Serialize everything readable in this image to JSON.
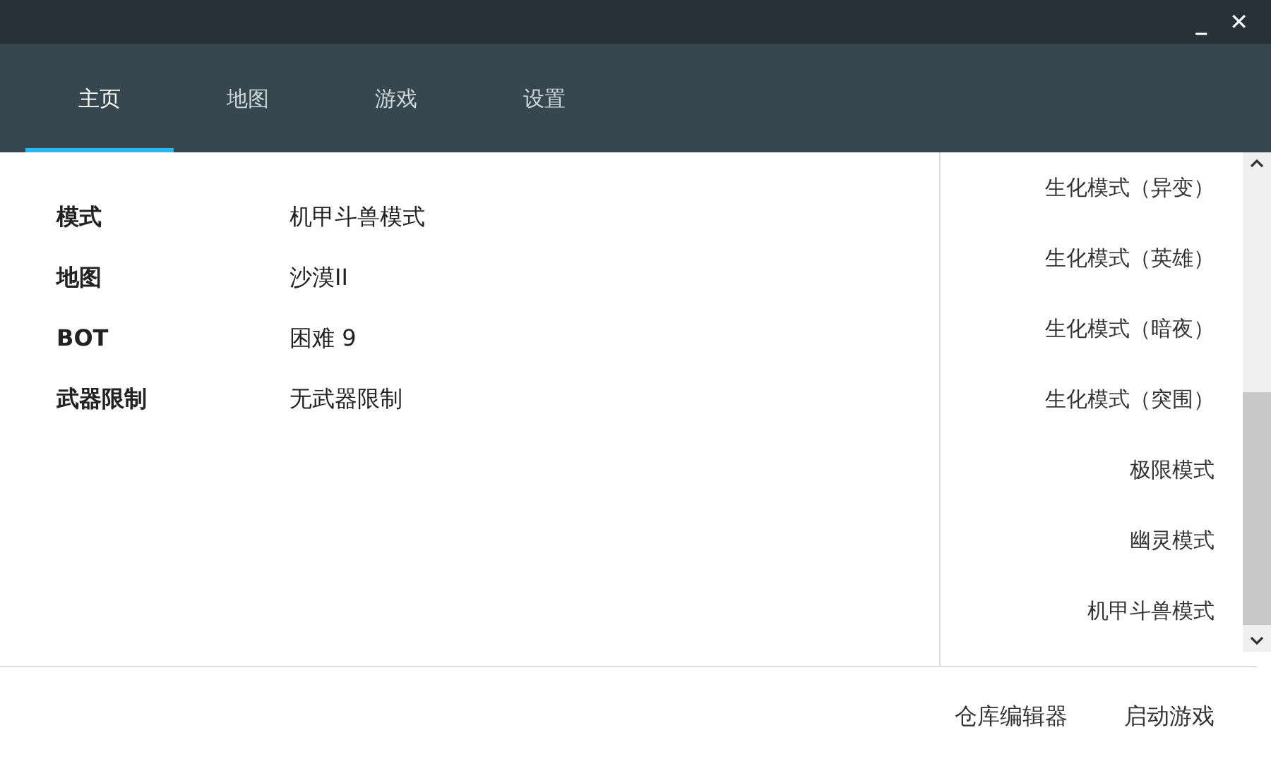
{
  "window": {
    "controls": [
      "_",
      "✕"
    ]
  },
  "tabs": [
    {
      "label": "主页",
      "selected": true
    },
    {
      "label": "地图",
      "selected": false
    },
    {
      "label": "游戏",
      "selected": false
    },
    {
      "label": "设置",
      "selected": false
    }
  ],
  "settings": [
    {
      "label": "模式",
      "value": "机甲斗兽模式"
    },
    {
      "label": "地图",
      "value": "沙漠II"
    },
    {
      "label": "BOT",
      "value": "困难 9"
    },
    {
      "label": "武器限制",
      "value": "无武器限制"
    }
  ],
  "mode_list": [
    "生化模式（异变）",
    "生化模式（英雄）",
    "生化模式（暗夜）",
    "生化模式（突围）",
    "极限模式",
    "幽灵模式",
    "机甲斗兽模式"
  ],
  "buttons": [
    "仓库编辑器",
    "启动游戏"
  ]
}
